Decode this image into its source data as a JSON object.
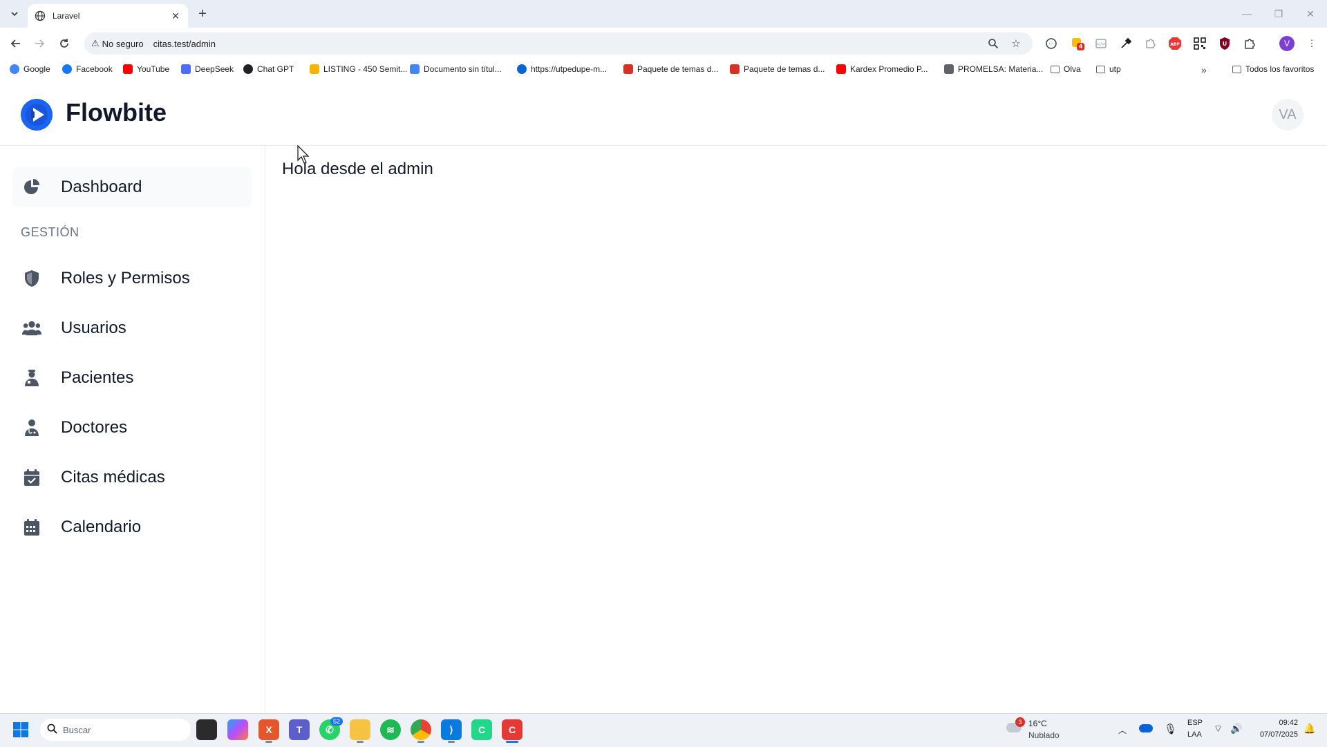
{
  "browser": {
    "tab_title": "Laravel",
    "omnibox": {
      "security_label": "No seguro",
      "url": "citas.test/admin"
    },
    "bookmarks": [
      {
        "label": "Google",
        "icon": "google-icon",
        "color": "#4285f4"
      },
      {
        "label": "Facebook",
        "icon": "facebook-icon",
        "color": "#1877f2"
      },
      {
        "label": "YouTube",
        "icon": "youtube-icon",
        "color": "#ff0000"
      },
      {
        "label": "DeepSeek",
        "icon": "deepseek-icon",
        "color": "#4d6bfe"
      },
      {
        "label": "Chat GPT",
        "icon": "chatgpt-icon",
        "color": "#202123"
      },
      {
        "label": "LISTING - 450 Semit...",
        "icon": "drive-icon",
        "color": "#f4b400"
      },
      {
        "label": "Documento sin títul...",
        "icon": "docs-icon",
        "color": "#4285f4"
      },
      {
        "label": "https://utpedupe-m...",
        "icon": "onedrive-icon",
        "color": "#0a64d6"
      },
      {
        "label": "Paquete de temas d...",
        "icon": "pdf-icon",
        "color": "#d93025"
      },
      {
        "label": "Paquete de temas d...",
        "icon": "pdf-icon",
        "color": "#d93025"
      },
      {
        "label": "Kardex Promedio P...",
        "icon": "youtube-icon",
        "color": "#ff0000"
      },
      {
        "label": "PROMELSA: Materia...",
        "icon": "promelsa-icon",
        "color": "#5f6368"
      },
      {
        "label": "Olva",
        "icon": "folder-icon",
        "color": "#5f6368"
      },
      {
        "label": "utp",
        "icon": "folder-icon",
        "color": "#5f6368"
      }
    ],
    "all_bookmarks_label": "Todos los favoritos",
    "extension_badge": "4",
    "profile_initial": "V"
  },
  "app": {
    "brand": "Flowbite",
    "user_initials": "VA",
    "sidebar": {
      "dashboard": "Dashboard",
      "section_heading": "GESTIÓN",
      "items": [
        {
          "label": "Roles y Permisos",
          "icon": "shield-icon"
        },
        {
          "label": "Usuarios",
          "icon": "users-icon"
        },
        {
          "label": "Pacientes",
          "icon": "patient-icon"
        },
        {
          "label": "Doctores",
          "icon": "doctor-icon"
        },
        {
          "label": "Citas médicas",
          "icon": "calendar-check-icon"
        },
        {
          "label": "Calendario",
          "icon": "calendar-icon"
        }
      ]
    },
    "main": {
      "greeting": "Hola desde el admin"
    }
  },
  "taskbar": {
    "search_placeholder": "Buscar",
    "whatsapp_badge": "52",
    "weather": {
      "badge": "3",
      "temp": "16°C",
      "condition": "Nublado"
    },
    "language": {
      "line1": "ESP",
      "line2": "LAA"
    },
    "clock": {
      "time": "09:42",
      "date": "07/07/2025"
    }
  }
}
